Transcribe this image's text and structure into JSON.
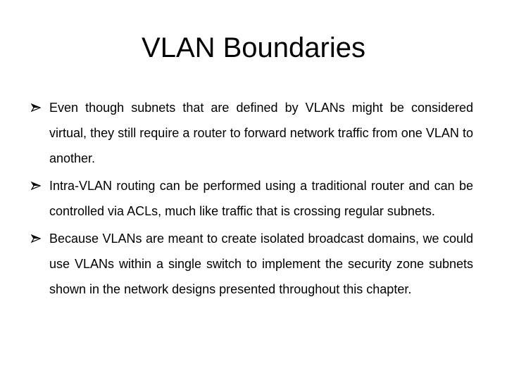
{
  "slide": {
    "title": "VLAN Boundaries",
    "bullets": [
      {
        "icon": "arrowhead-bullet-icon",
        "text": "Even though subnets that are defined by VLANs might be considered virtual, they still require a router to forward network traffic from one VLAN to another."
      },
      {
        "icon": "arrowhead-bullet-icon",
        "text": "Intra-VLAN routing can be performed using a traditional router and can be controlled via ACLs, much like traffic that is crossing regular subnets."
      },
      {
        "icon": "arrowhead-bullet-icon",
        "text": "Because VLANs are meant to create isolated broadcast domains, we could use VLANs within a single switch to implement the security zone subnets shown in the network designs presented throughout this chapter."
      }
    ]
  }
}
